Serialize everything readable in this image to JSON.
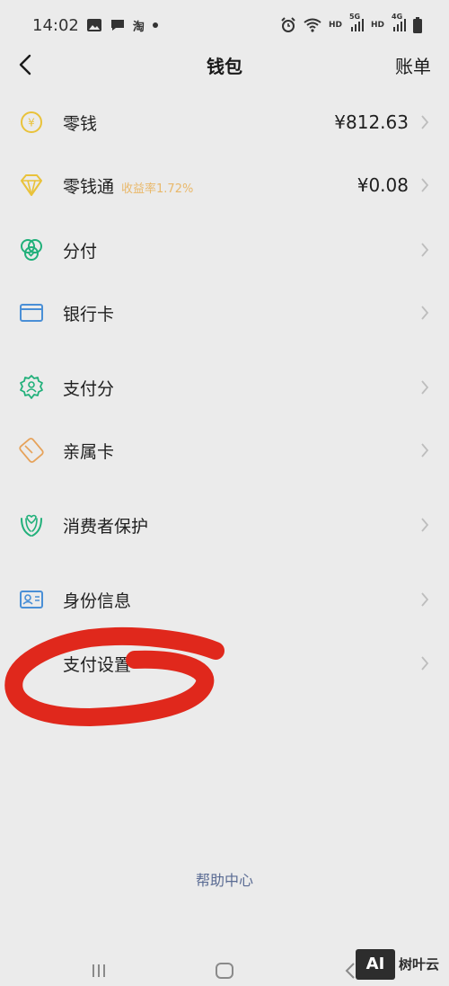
{
  "status_bar": {
    "time": "14:02",
    "app_icon_text": "淘",
    "hd1": "HD",
    "net1": "5G",
    "hd2": "HD",
    "net2": "4G"
  },
  "nav": {
    "title": "钱包",
    "action": "账单"
  },
  "items": [
    {
      "label": "零钱",
      "value": "¥812.63",
      "icon": "yuan-coin-icon"
    },
    {
      "label": "零钱通",
      "sub": "收益率1.72%",
      "value": "¥0.08",
      "icon": "diamond-icon"
    },
    {
      "label": "分付",
      "icon": "fenfu-icon"
    },
    {
      "label": "银行卡",
      "icon": "bank-card-icon"
    },
    {
      "label": "支付分",
      "icon": "payscore-icon"
    },
    {
      "label": "亲属卡",
      "icon": "family-card-icon"
    },
    {
      "label": "消费者保护",
      "icon": "consumer-protection-icon"
    },
    {
      "label": "身份信息",
      "icon": "id-card-icon"
    },
    {
      "label": "支付设置"
    }
  ],
  "help": "帮助中心",
  "watermark": {
    "logo": "AI",
    "text": "树叶云"
  },
  "colors": {
    "accent_green": "#21b07a",
    "accent_yellow": "#e9c23a",
    "accent_orange": "#e6a25a",
    "link_blue": "#5a6b93",
    "scribble_red": "#e0281c"
  }
}
